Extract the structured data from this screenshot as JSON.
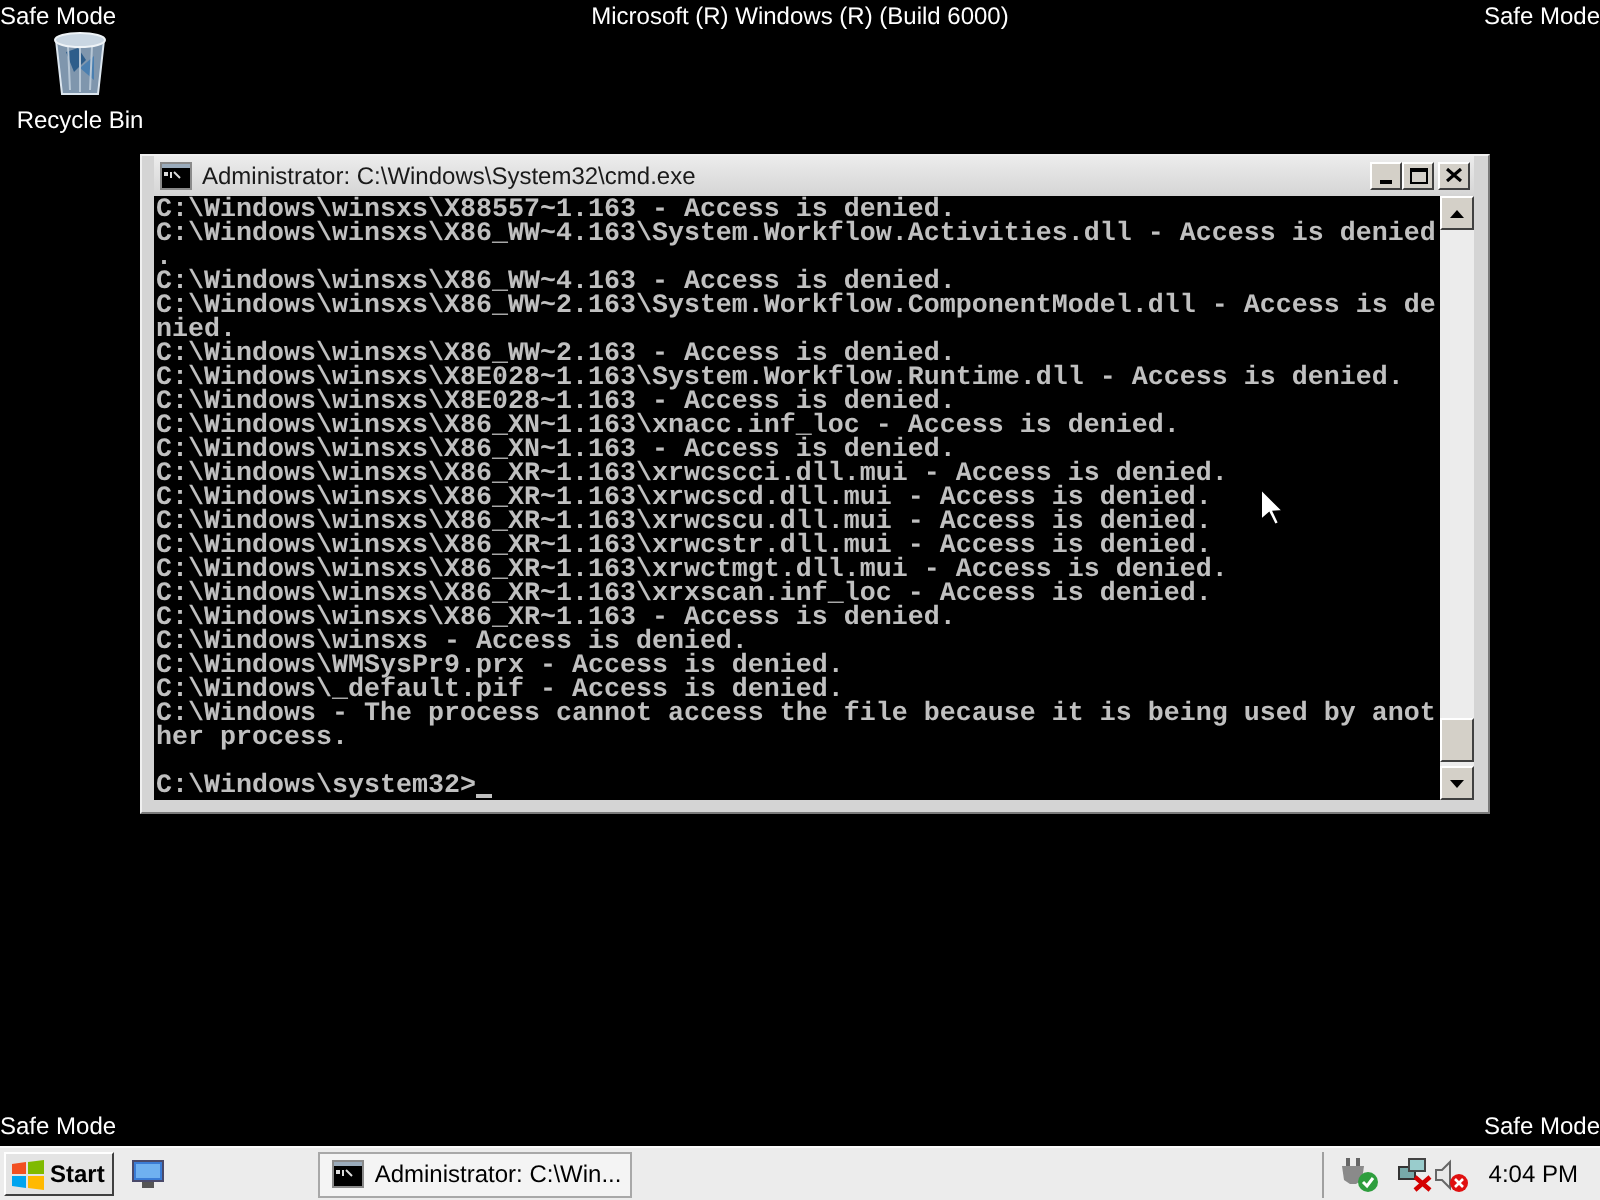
{
  "desktop": {
    "top_left_label": "Safe Mode",
    "banner": "Microsoft (R) Windows (R) (Build 6000)",
    "top_right_label": "Safe Mode",
    "bottom_left_label": "Safe Mode",
    "bottom_right_label": "Safe Mode",
    "icons": [
      {
        "label": "Recycle Bin"
      }
    ]
  },
  "console_window": {
    "title": "Administrator: C:\\Windows\\System32\\cmd.exe",
    "lines": [
      "C:\\Windows\\winsxs\\X88557~1.163 - Access is denied.",
      "C:\\Windows\\winsxs\\X86_WW~4.163\\System.Workflow.Activities.dll - Access is denied",
      ".",
      "C:\\Windows\\winsxs\\X86_WW~4.163 - Access is denied.",
      "C:\\Windows\\winsxs\\X86_WW~2.163\\System.Workflow.ComponentModel.dll - Access is de",
      "nied.",
      "C:\\Windows\\winsxs\\X86_WW~2.163 - Access is denied.",
      "C:\\Windows\\winsxs\\X8E028~1.163\\System.Workflow.Runtime.dll - Access is denied.",
      "C:\\Windows\\winsxs\\X8E028~1.163 - Access is denied.",
      "C:\\Windows\\winsxs\\X86_XN~1.163\\xnacc.inf_loc - Access is denied.",
      "C:\\Windows\\winsxs\\X86_XN~1.163 - Access is denied.",
      "C:\\Windows\\winsxs\\X86_XR~1.163\\xrwcscci.dll.mui - Access is denied.",
      "C:\\Windows\\winsxs\\X86_XR~1.163\\xrwcscd.dll.mui - Access is denied.",
      "C:\\Windows\\winsxs\\X86_XR~1.163\\xrwcscu.dll.mui - Access is denied.",
      "C:\\Windows\\winsxs\\X86_XR~1.163\\xrwcstr.dll.mui - Access is denied.",
      "C:\\Windows\\winsxs\\X86_XR~1.163\\xrwctmgt.dll.mui - Access is denied.",
      "C:\\Windows\\winsxs\\X86_XR~1.163\\xrxscan.inf_loc - Access is denied.",
      "C:\\Windows\\winsxs\\X86_XR~1.163 - Access is denied.",
      "C:\\Windows\\winsxs - Access is denied.",
      "C:\\Windows\\WMSysPr9.prx - Access is denied.",
      "C:\\Windows\\_default.pif - Access is denied.",
      "C:\\Windows - The process cannot access the file because it is being used by anot",
      "her process."
    ],
    "prompt": "C:\\Windows\\system32>"
  },
  "taskbar": {
    "start": "Start",
    "tasks": [
      {
        "label": "Administrator: C:\\Win...",
        "selected": false
      }
    ],
    "clock": "4:04 PM"
  }
}
